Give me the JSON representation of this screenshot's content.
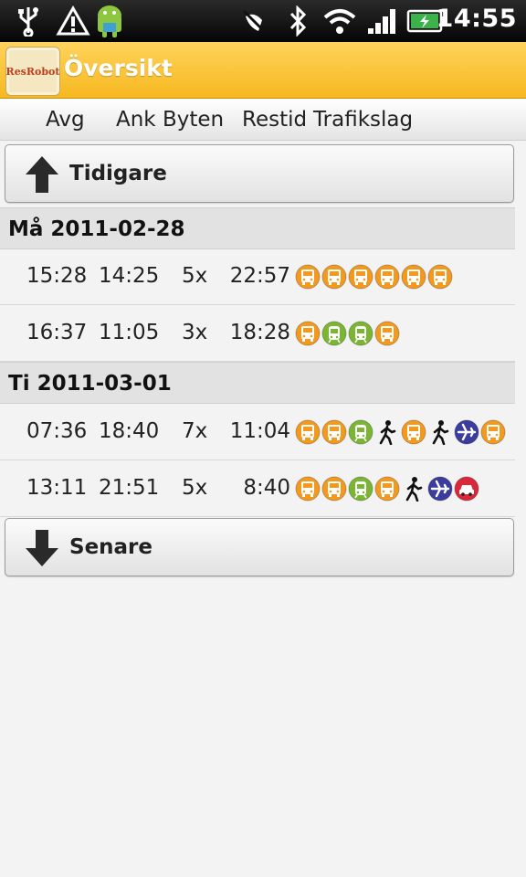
{
  "status_bar": {
    "time": "14:55",
    "icons": [
      "usb-icon",
      "warning-icon",
      "android-icon",
      "mute-icon",
      "bluetooth-icon",
      "wifi-icon",
      "signal-icon",
      "battery-icon"
    ]
  },
  "app": {
    "logo_text": "ResRobot",
    "title": "Översikt"
  },
  "columns": {
    "departure": "Avg",
    "arrival": "Ank",
    "changes": "Byten",
    "duration": "Restid",
    "modes": "Trafikslag"
  },
  "buttons": {
    "earlier": "Tidigare",
    "later": "Senare"
  },
  "colors": {
    "bus_orange": "#f39a1e",
    "tram_green": "#7ab534",
    "flight_purple": "#3c3c9e",
    "taxi_red": "#d9283a",
    "title_bar": "#f9c43a"
  },
  "days": [
    {
      "date": "Må 2011-02-28",
      "trips": [
        {
          "departure": "15:28",
          "arrival": "14:25",
          "changes": "5x",
          "duration": "22:57",
          "modes": [
            "bus",
            "bus",
            "bus",
            "bus",
            "bus",
            "bus"
          ]
        },
        {
          "departure": "16:37",
          "arrival": "11:05",
          "changes": "3x",
          "duration": "18:28",
          "modes": [
            "bus",
            "tram",
            "tram",
            "bus"
          ]
        }
      ]
    },
    {
      "date": "Ti 2011-03-01",
      "trips": [
        {
          "departure": "07:36",
          "arrival": "18:40",
          "changes": "7x",
          "duration": "11:04",
          "modes": [
            "bus",
            "bus",
            "tram",
            "walk",
            "bus",
            "walk",
            "flight",
            "bus"
          ]
        },
        {
          "departure": "13:11",
          "arrival": "21:51",
          "changes": "5x",
          "duration": "8:40",
          "modes": [
            "bus",
            "bus",
            "tram",
            "bus",
            "walk",
            "flight",
            "taxi"
          ]
        }
      ]
    }
  ]
}
